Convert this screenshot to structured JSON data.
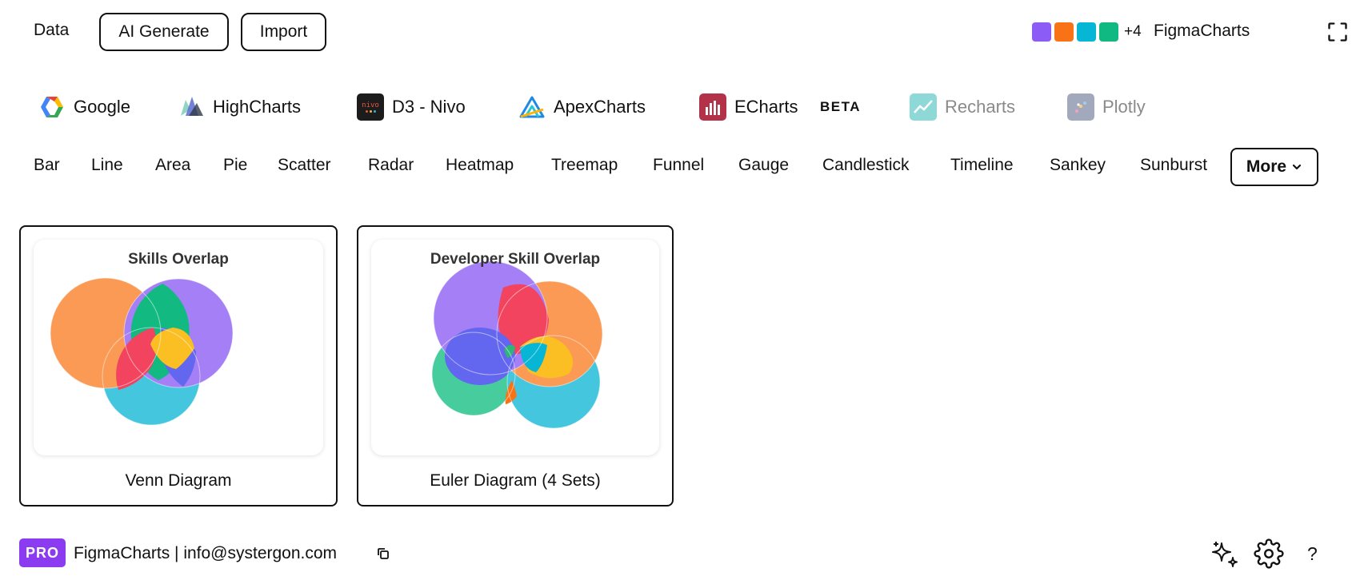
{
  "topbar": {
    "data_label": "Data",
    "ai_generate_label": "AI Generate",
    "import_label": "Import",
    "swatch_colors": [
      "#8b5cf6",
      "#f97316",
      "#06b6d4",
      "#10b981"
    ],
    "plus_count": "+4",
    "brand": "FigmaCharts",
    "fullscreen_icon": "fullscreen-icon"
  },
  "libraries": [
    {
      "label": "Google",
      "icon": "google-logo-icon"
    },
    {
      "label": "HighCharts",
      "icon": "highcharts-logo-icon"
    },
    {
      "label": "D3 - Nivo",
      "icon": "nivo-logo-icon",
      "logo_text": "nivo"
    },
    {
      "label": "ApexCharts",
      "icon": "apexcharts-logo-icon"
    },
    {
      "label": "ECharts",
      "icon": "echarts-logo-icon",
      "badge": "BETA"
    },
    {
      "label": "Recharts",
      "icon": "recharts-logo-icon"
    },
    {
      "label": "Plotly",
      "icon": "plotly-logo-icon"
    }
  ],
  "chart_types": [
    "Bar",
    "Line",
    "Area",
    "Pie",
    "Scatter",
    "Radar",
    "Heatmap",
    "Treemap",
    "Funnel",
    "Gauge",
    "Candlestick",
    "Timeline",
    "Sankey",
    "Sunburst"
  ],
  "more_label": "More",
  "cards": [
    {
      "preview_title": "Skills Overlap",
      "label": "Venn Diagram"
    },
    {
      "preview_title": "Developer Skill Overlap",
      "label": "Euler Diagram (4 Sets)"
    }
  ],
  "footer": {
    "pro_badge": "PRO",
    "text": "FigmaCharts | info@systergon.com",
    "icons": [
      "copy-icon",
      "sparkle-icon",
      "gear-icon",
      "help-icon"
    ],
    "help_label": "?"
  }
}
